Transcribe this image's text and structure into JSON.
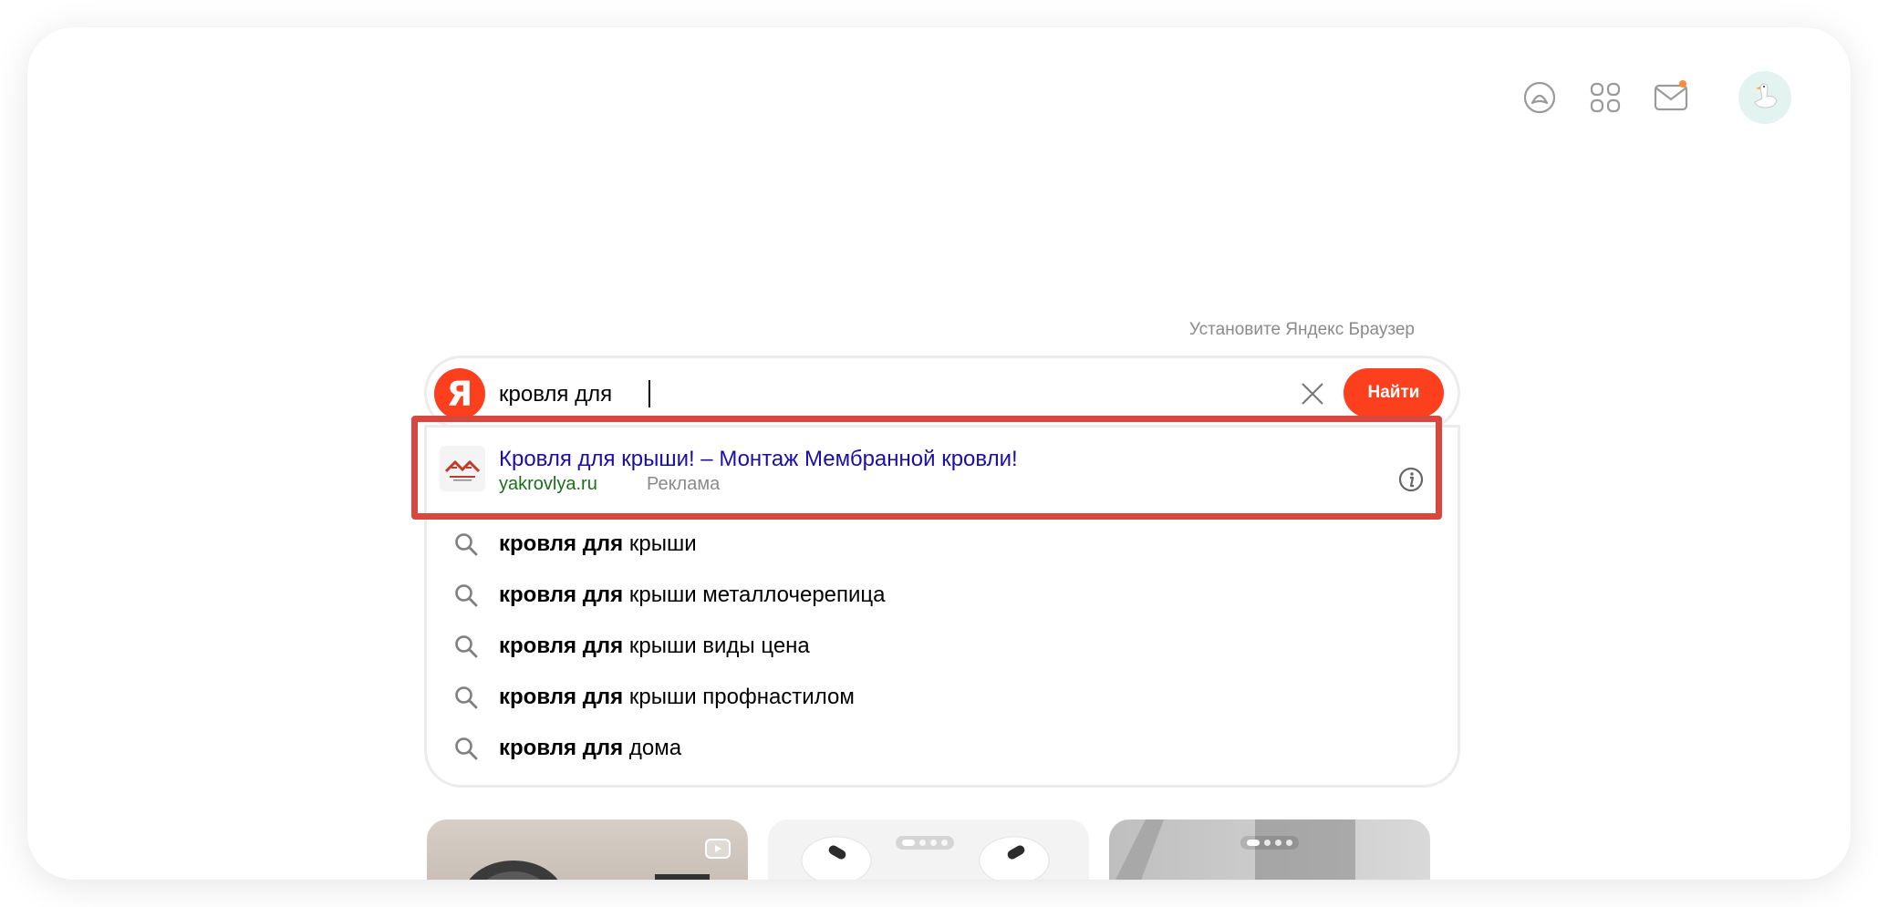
{
  "header": {
    "icons": [
      "alice-icon",
      "services-grid-icon",
      "mail-icon",
      "avatar"
    ]
  },
  "install_link": "Установите Яндекс Браузер",
  "search": {
    "logo_letter": "Я",
    "query": "кровля для ",
    "find_label": "Найти"
  },
  "ad": {
    "title": "Кровля для крыши! – Монтаж Мембранной кровли!",
    "domain": "yakrovlya.ru",
    "tag": "Реклама"
  },
  "suggestions": [
    {
      "bold": "кровля для",
      "rest": " крыши"
    },
    {
      "bold": "кровля для",
      "rest": " крыши металлочерепица"
    },
    {
      "bold": "кровля для",
      "rest": " крыши виды цена"
    },
    {
      "bold": "кровля для",
      "rest": " крыши профнастилом"
    },
    {
      "bold": "кровля для",
      "rest": " дома"
    }
  ],
  "colors": {
    "brand": "#fc3f1d",
    "highlight": "#d9463e",
    "ad_title": "#1a0dab",
    "ad_domain": "#1b6f1b"
  }
}
